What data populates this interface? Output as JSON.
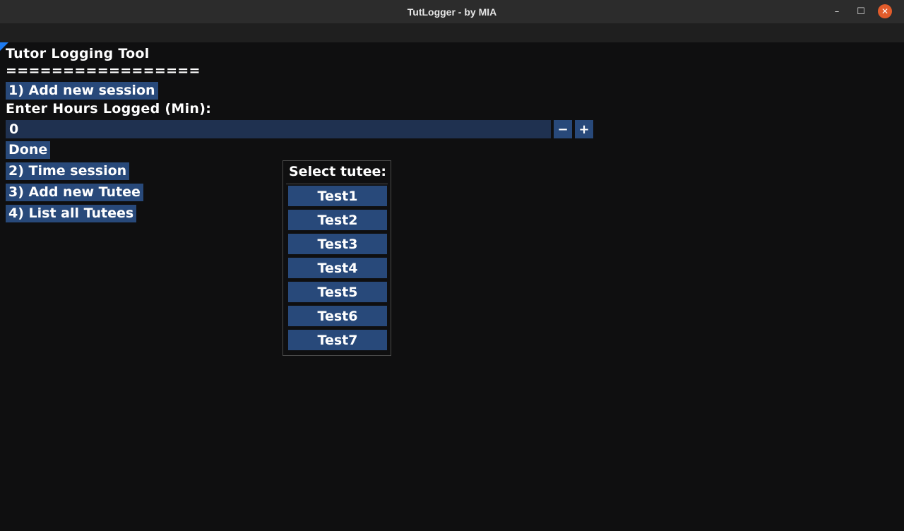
{
  "window": {
    "title": "TutLogger - by MIA",
    "minimize_glyph": "–",
    "maximize_glyph": "☐",
    "close_glyph": "✕"
  },
  "app": {
    "heading": "Tutor Logging Tool",
    "divider": "=================",
    "add_session_button": "1) Add new session",
    "hours_label": "Enter Hours Logged (Min):",
    "hours_value": "0",
    "minus_glyph": "−",
    "plus_glyph": "+",
    "done_button": "Done",
    "time_session_button": "2) Time session",
    "add_tutee_button": "3) Add new Tutee",
    "list_tutees_button": "4) List all Tutees"
  },
  "popup": {
    "title": "Select tutee:",
    "items": [
      "Test1",
      "Test2",
      "Test3",
      "Test4",
      "Test5",
      "Test6",
      "Test7"
    ]
  },
  "colors": {
    "accent": "#28497a",
    "input_bg": "#1f3150",
    "background": "#0f0f10",
    "close_button": "#e25c2b"
  }
}
